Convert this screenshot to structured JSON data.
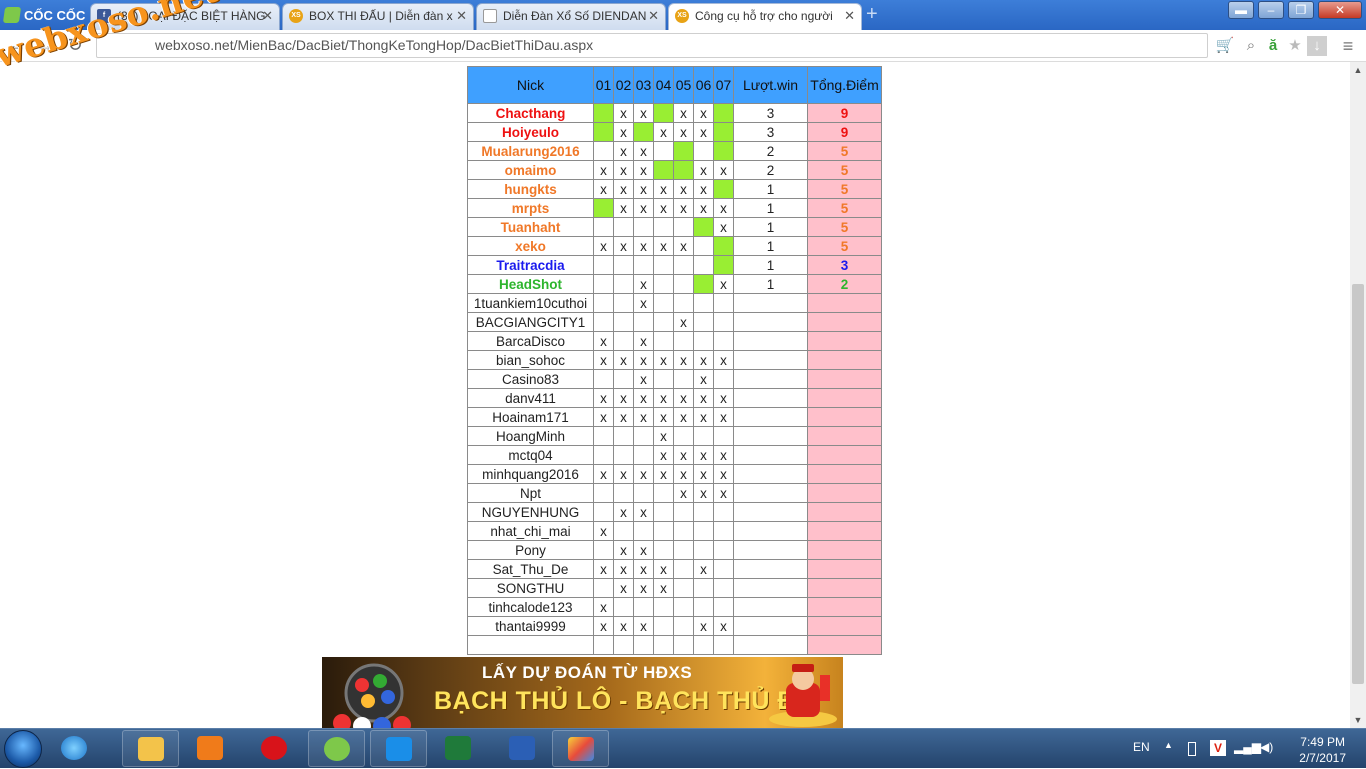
{
  "browser": {
    "brand": "CỐC CỐC",
    "url": "webxoso.net/MienBac/DacBiet/ThongKeTongHop/DacBietThiDau.aspx",
    "tabs": [
      {
        "label": "(32) LOẠI ĐẶC BIỆT HÀNG"
      },
      {
        "label": "BOX THI ĐẤU | Diễn đàn x"
      },
      {
        "label": "Diễn Đàn Xổ Số DIENDAN"
      },
      {
        "label": "Công cụ hỗ trợ cho người"
      }
    ]
  },
  "watermark": "webxoso.net",
  "table": {
    "headers": {
      "nick": "Nick",
      "days": [
        "01",
        "02",
        "03",
        "04",
        "05",
        "06",
        "07"
      ],
      "luot": "Lượt.win",
      "tong": "Tổng.Điểm"
    },
    "rows": [
      {
        "nick": "Chacthang",
        "color": "#ee1111",
        "cells": [
          "g",
          "x",
          "x",
          "g",
          "x",
          "x",
          "g"
        ],
        "luot": "3",
        "score": "9"
      },
      {
        "nick": "Hoiyeulo",
        "color": "#ee1111",
        "cells": [
          "g",
          "x",
          "g",
          "x",
          "x",
          "x",
          "g"
        ],
        "luot": "3",
        "score": "9"
      },
      {
        "nick": "Mualarung2016",
        "color": "#f07828",
        "cells": [
          "",
          "x",
          "x",
          "",
          "g",
          "",
          "g"
        ],
        "luot": "2",
        "score": "5"
      },
      {
        "nick": "omaimo",
        "color": "#f07828",
        "cells": [
          "x",
          "x",
          "x",
          "g",
          "g",
          "x",
          "x"
        ],
        "luot": "2",
        "score": "5"
      },
      {
        "nick": "hungkts",
        "color": "#f07828",
        "cells": [
          "x",
          "x",
          "x",
          "x",
          "x",
          "x",
          "g"
        ],
        "luot": "1",
        "score": "5"
      },
      {
        "nick": "mrpts",
        "color": "#f07828",
        "cells": [
          "g",
          "x",
          "x",
          "x",
          "x",
          "x",
          "x"
        ],
        "luot": "1",
        "score": "5"
      },
      {
        "nick": "Tuanhaht",
        "color": "#f07828",
        "cells": [
          "",
          "",
          "",
          "",
          "",
          "g",
          "x"
        ],
        "luot": "1",
        "score": "5"
      },
      {
        "nick": "xeko",
        "color": "#f07828",
        "cells": [
          "x",
          "x",
          "x",
          "x",
          "x",
          "",
          "g"
        ],
        "luot": "1",
        "score": "5"
      },
      {
        "nick": "Traitracdia",
        "color": "#1a1aee",
        "cells": [
          "",
          "",
          "",
          "",
          "",
          "",
          "g"
        ],
        "luot": "1",
        "score": "3"
      },
      {
        "nick": "HeadShot",
        "color": "#2db52d",
        "cells": [
          "",
          "",
          "x",
          "",
          "",
          "g",
          "x"
        ],
        "luot": "1",
        "score": "2"
      },
      {
        "nick": "1tuankiem10cuthoi",
        "color": "",
        "cells": [
          "",
          "",
          "x",
          "",
          "",
          "",
          ""
        ],
        "luot": "",
        "score": ""
      },
      {
        "nick": "BACGIANGCITY1",
        "color": "",
        "cells": [
          "",
          "",
          "",
          "",
          "x",
          "",
          ""
        ],
        "luot": "",
        "score": ""
      },
      {
        "nick": "BarcaDisco",
        "color": "",
        "cells": [
          "x",
          "",
          "x",
          "",
          "",
          "",
          ""
        ],
        "luot": "",
        "score": ""
      },
      {
        "nick": "bian_sohoc",
        "color": "",
        "cells": [
          "x",
          "x",
          "x",
          "x",
          "x",
          "x",
          "x"
        ],
        "luot": "",
        "score": ""
      },
      {
        "nick": "Casino83",
        "color": "",
        "cells": [
          "",
          "",
          "x",
          "",
          "",
          "x",
          ""
        ],
        "luot": "",
        "score": ""
      },
      {
        "nick": "danv411",
        "color": "",
        "cells": [
          "x",
          "x",
          "x",
          "x",
          "x",
          "x",
          "x"
        ],
        "luot": "",
        "score": ""
      },
      {
        "nick": "Hoainam171",
        "color": "",
        "cells": [
          "x",
          "x",
          "x",
          "x",
          "x",
          "x",
          "x"
        ],
        "luot": "",
        "score": ""
      },
      {
        "nick": "HoangMinh",
        "color": "",
        "cells": [
          "",
          "",
          "",
          "x",
          "",
          "",
          ""
        ],
        "luot": "",
        "score": ""
      },
      {
        "nick": "mctq04",
        "color": "",
        "cells": [
          "",
          "",
          "",
          "x",
          "x",
          "x",
          "x"
        ],
        "luot": "",
        "score": ""
      },
      {
        "nick": "minhquang2016",
        "color": "",
        "cells": [
          "x",
          "x",
          "x",
          "x",
          "x",
          "x",
          "x"
        ],
        "luot": "",
        "score": ""
      },
      {
        "nick": "Npt",
        "color": "",
        "cells": [
          "",
          "",
          "",
          "",
          "x",
          "x",
          "x"
        ],
        "luot": "",
        "score": ""
      },
      {
        "nick": "NGUYENHUNG",
        "color": "",
        "cells": [
          "",
          "x",
          "x",
          "",
          "",
          "",
          ""
        ],
        "luot": "",
        "score": ""
      },
      {
        "nick": "nhat_chi_mai",
        "color": "",
        "cells": [
          "x",
          "",
          "",
          "",
          "",
          "",
          ""
        ],
        "luot": "",
        "score": ""
      },
      {
        "nick": "Pony",
        "color": "",
        "cells": [
          "",
          "x",
          "x",
          "",
          "",
          "",
          ""
        ],
        "luot": "",
        "score": ""
      },
      {
        "nick": "Sat_Thu_De",
        "color": "",
        "cells": [
          "x",
          "x",
          "x",
          "x",
          "",
          "x",
          ""
        ],
        "luot": "",
        "score": ""
      },
      {
        "nick": "SONGTHU",
        "color": "",
        "cells": [
          "",
          "x",
          "x",
          "x",
          "",
          "",
          ""
        ],
        "luot": "",
        "score": ""
      },
      {
        "nick": "tinhcalode123",
        "color": "",
        "cells": [
          "x",
          "",
          "",
          "",
          "",
          "",
          ""
        ],
        "luot": "",
        "score": ""
      },
      {
        "nick": "thantai9999",
        "color": "",
        "cells": [
          "x",
          "x",
          "x",
          "",
          "",
          "x",
          "x"
        ],
        "luot": "",
        "score": ""
      },
      {
        "nick": "",
        "color": "",
        "cells": [
          "",
          "",
          "",
          "",
          "",
          "",
          ""
        ],
        "luot": "",
        "score": ""
      }
    ]
  },
  "banner": {
    "line1": "LẤY DỰ ĐOÁN TỪ HĐXS",
    "line2": "BẠCH THỦ LÔ - BẠCH THỦ ĐỀ"
  },
  "taskbar": {
    "lang": "EN",
    "time": "7:49 PM",
    "date": "2/7/2017"
  },
  "colors": {
    "win_cell": "#99ee33",
    "score_cell": "#ffc0cb",
    "header": "#3fa0ff"
  }
}
